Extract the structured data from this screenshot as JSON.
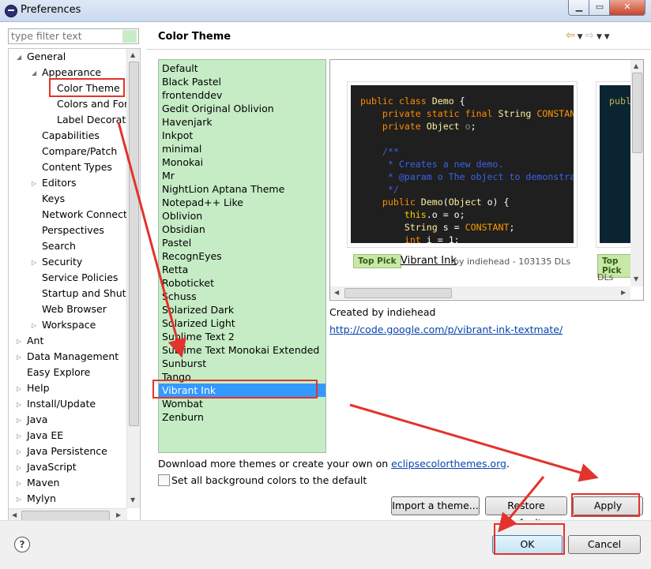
{
  "window": {
    "title": "Preferences"
  },
  "filter": {
    "placeholder": "type filter text"
  },
  "tree": {
    "items": [
      {
        "label": "General",
        "expanded": true
      },
      {
        "label": "Appearance",
        "expanded": true
      },
      {
        "label": "Color Theme",
        "selected": true
      },
      {
        "label": "Colors and Fonts"
      },
      {
        "label": "Label Decorations"
      },
      {
        "label": "Capabilities"
      },
      {
        "label": "Compare/Patch"
      },
      {
        "label": "Content Types"
      },
      {
        "label": "Editors"
      },
      {
        "label": "Keys"
      },
      {
        "label": "Network Connections"
      },
      {
        "label": "Perspectives"
      },
      {
        "label": "Search"
      },
      {
        "label": "Security"
      },
      {
        "label": "Service Policies"
      },
      {
        "label": "Startup and Shutdown"
      },
      {
        "label": "Web Browser"
      },
      {
        "label": "Workspace"
      },
      {
        "label": "Ant"
      },
      {
        "label": "Data Management"
      },
      {
        "label": "Easy Explore"
      },
      {
        "label": "Help"
      },
      {
        "label": "Install/Update"
      },
      {
        "label": "Java"
      },
      {
        "label": "Java EE"
      },
      {
        "label": "Java Persistence"
      },
      {
        "label": "JavaScript"
      },
      {
        "label": "Maven"
      },
      {
        "label": "Mylyn"
      }
    ]
  },
  "page": {
    "title": "Color Theme"
  },
  "themes": {
    "items": [
      "Default",
      "Black Pastel",
      "frontenddev",
      "Gedit Original Oblivion",
      "Havenjark",
      "Inkpot",
      "minimal",
      "Monokai",
      "Mr",
      "NightLion Aptana Theme",
      "Notepad++ Like",
      "Oblivion",
      "Obsidian",
      "Pastel",
      "RecognEyes",
      "Retta",
      "Roboticket",
      "Schuss",
      "Solarized Dark",
      "Solarized Light",
      "Sublime Text 2",
      "Sublime Text Monokai Extended",
      "Sunburst",
      "Tango",
      "Vibrant Ink",
      "Wombat",
      "Zenburn"
    ],
    "selected": "Vibrant Ink"
  },
  "preview": {
    "badge": "Top Pick",
    "theme_name": "Vibrant Ink",
    "theme_meta": "by indiehead - 103135 DLs",
    "second_meta": "DLs",
    "code": {
      "l1a": "public class ",
      "l1b": "Demo",
      "l1c": " {",
      "l2a": "private static final ",
      "l2b": "String",
      "l2c": " CONSTAN",
      "l3a": "private ",
      "l3b": "Object",
      "l3c": " o",
      "l5": "/**",
      "l6": " * Creates a new demo.",
      "l7": " * @param o The object to demonstra",
      "l8": " */",
      "l9a": "public ",
      "l9b": "Demo",
      "l9c": "(",
      "l9d": "Object",
      "l9e": " o) {",
      "l10a": "this",
      "l10b": ".o = o;",
      "l11a": "String",
      "l11b": " s = ",
      "l11c": "CONSTANT",
      "l12a": "int",
      "l12b": " i = 1;",
      "c2a": "publ"
    }
  },
  "details": {
    "created_by": "Created by indiehead",
    "link": "http://code.google.com/p/vibrant-ink-textmate/"
  },
  "download": {
    "prefix": "Download more themes or create your own on ",
    "link": "eclipsecolorthemes.org",
    "suffix": "."
  },
  "checkbox": {
    "label": "Set all background colors to the default",
    "checked": false
  },
  "buttons": {
    "import": "Import a theme...",
    "restore": "Restore Defaults",
    "apply": "Apply",
    "ok": "OK",
    "cancel": "Cancel"
  },
  "colors": {
    "highlight": "#e2332c",
    "list_bg": "#c6ecc6",
    "selection": "#3399ff"
  }
}
